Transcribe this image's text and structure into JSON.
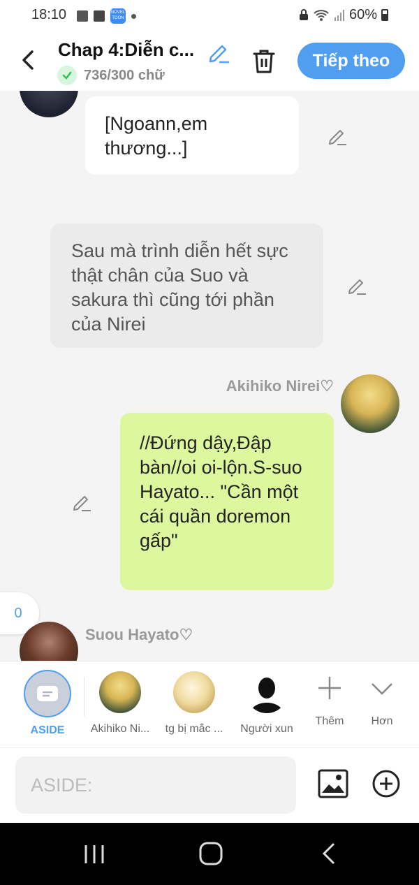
{
  "status_bar": {
    "time": "18:10",
    "battery": "60%",
    "novel_toon_badge": "NOVEL TOON"
  },
  "header": {
    "title": "Chap 4:Diễn c...",
    "word_count": "736/300 chữ",
    "next_button": "Tiếp theo"
  },
  "messages": [
    {
      "text": "[Ngoann,em thương...]"
    },
    {
      "text": "Sau mà trình diễn hết sực thật chân của Suo và sakura thì cũng tới phần của Nirei"
    },
    {
      "speaker": "Akihiko Nirei♡",
      "text": "//Đứng dậy,Đập bàn//oi oi-lộn.S-suo Hayato... \"Cần một cái quần doremon gấp\""
    },
    {
      "speaker": "Suou Hayato♡"
    }
  ],
  "counter_badge": "0",
  "toolbar": {
    "aside_label": "ASIDE",
    "characters": [
      {
        "label": "Akihiko Ni..."
      },
      {
        "label": "tg bị mắc ..."
      },
      {
        "label": "Người xun"
      }
    ],
    "add_label": "Thêm",
    "more_label": "Hơn"
  },
  "input": {
    "placeholder": "ASIDE:"
  },
  "colors": {
    "accent": "#4f9ef0",
    "my_bubble": "#dcf79d",
    "narration_bubble": "#ebebeb",
    "background": "#f4f4f4"
  }
}
